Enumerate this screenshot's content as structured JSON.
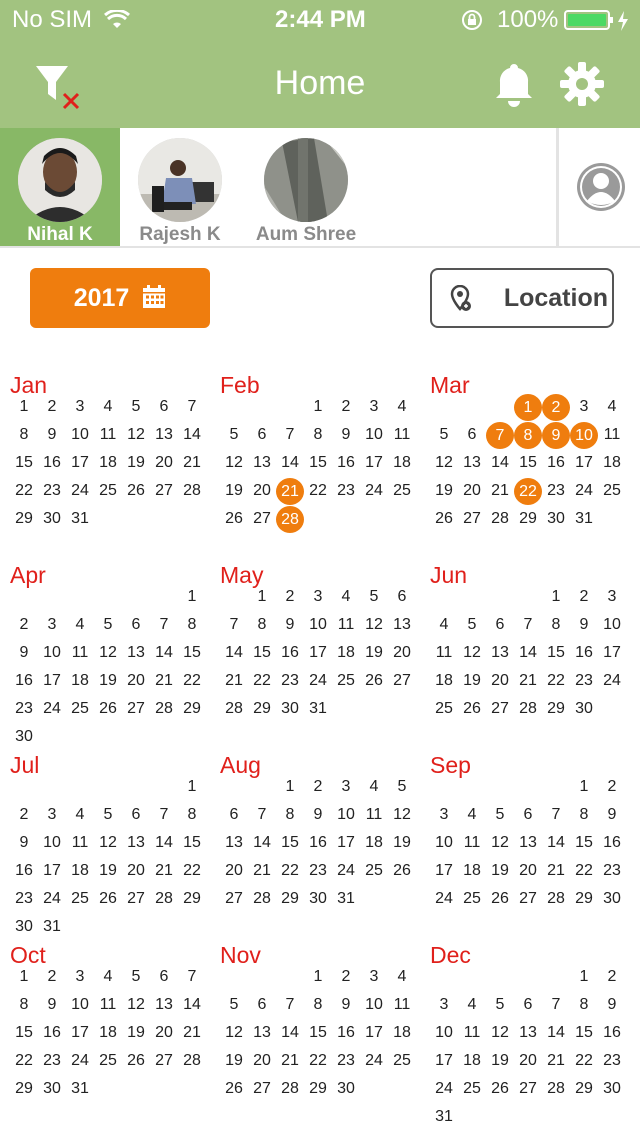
{
  "status_bar": {
    "carrier": "No SIM",
    "time": "2:44 PM",
    "battery": "100%"
  },
  "nav": {
    "title": "Home",
    "filter_icon": "filter-clear-icon",
    "bell_icon": "bell-icon",
    "settings_icon": "gear-icon"
  },
  "users": [
    {
      "name": "Nihal K",
      "selected": true
    },
    {
      "name": "Rajesh K",
      "selected": false
    },
    {
      "name": "Aum Shree",
      "selected": false
    }
  ],
  "controls": {
    "year_label": "2017",
    "location_label": "Location"
  },
  "colors": {
    "header": "#a2c380",
    "selected_user": "#88b866",
    "accent": "#ef7d0e",
    "month": "#e0201b"
  },
  "calendar": {
    "year": 2017,
    "months": [
      {
        "name": "Jan",
        "offset": 0,
        "days": 31,
        "highlighted": []
      },
      {
        "name": "Feb",
        "offset": 3,
        "days": 28,
        "highlighted": [
          21,
          28
        ]
      },
      {
        "name": "Mar",
        "offset": 3,
        "days": 31,
        "highlighted": [
          1,
          2,
          7,
          8,
          9,
          10,
          22
        ]
      },
      {
        "name": "Apr",
        "offset": 6,
        "days": 30,
        "highlighted": []
      },
      {
        "name": "May",
        "offset": 1,
        "days": 31,
        "highlighted": []
      },
      {
        "name": "Jun",
        "offset": 4,
        "days": 30,
        "highlighted": []
      },
      {
        "name": "Jul",
        "offset": 6,
        "days": 31,
        "highlighted": []
      },
      {
        "name": "Aug",
        "offset": 2,
        "days": 31,
        "highlighted": []
      },
      {
        "name": "Sep",
        "offset": 5,
        "days": 30,
        "highlighted": []
      },
      {
        "name": "Oct",
        "offset": 0,
        "days": 31,
        "highlighted": []
      },
      {
        "name": "Nov",
        "offset": 3,
        "days": 30,
        "highlighted": []
      },
      {
        "name": "Dec",
        "offset": 5,
        "days": 31,
        "highlighted": []
      }
    ]
  }
}
